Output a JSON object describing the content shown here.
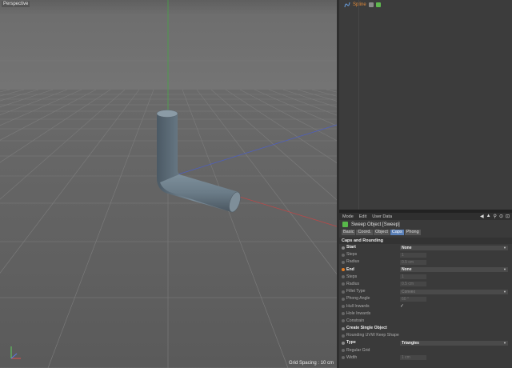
{
  "viewport": {
    "label": "Perspective",
    "grid_spacing": "Grid Spacing : 10 cm"
  },
  "object_manager": {
    "object_name": "Spline",
    "tag_colors": [
      "#8a8a8a",
      "#5fb84f"
    ]
  },
  "attribute_manager": {
    "menu": [
      "Mode",
      "Edit",
      "User Data"
    ],
    "object_title": "Sweep Object [Sweep]",
    "tabs": [
      "Basic",
      "Coord.",
      "Object",
      "Caps",
      "Phong"
    ],
    "active_tab": "Caps",
    "section": "Caps and Rounding",
    "params": [
      {
        "label": "Start",
        "value": "None",
        "kind": "dropdown",
        "hi": true
      },
      {
        "label": "Steps",
        "value": "1",
        "kind": "num",
        "dim": true
      },
      {
        "label": "Radius",
        "value": "0.5 cm",
        "kind": "num",
        "dim": true
      },
      {
        "label": "End",
        "value": "None",
        "kind": "dropdown",
        "hi": true,
        "orange": true
      },
      {
        "label": "Steps",
        "value": "1",
        "kind": "num",
        "dim": true
      },
      {
        "label": "Radius",
        "value": "0.5 cm",
        "kind": "num",
        "dim": true
      },
      {
        "label": "Fillet Type",
        "value": "Convex",
        "kind": "dropdown",
        "dim": true
      },
      {
        "label": "Phong Angle",
        "value": "60 °",
        "kind": "num",
        "dim": true
      },
      {
        "label": "Hull Inwards",
        "value": "✓",
        "kind": "check"
      },
      {
        "label": "Hole Inwards",
        "value": "",
        "kind": "check"
      },
      {
        "label": "Constrain",
        "value": "",
        "kind": "check"
      },
      {
        "label": "Create Single Object",
        "value": "",
        "kind": "check",
        "hi": true
      },
      {
        "label": "Rounding UVW Keep Shape",
        "value": "",
        "kind": "check"
      },
      {
        "label": "Type",
        "value": "Triangles",
        "kind": "dropdown",
        "hi": true
      },
      {
        "label": "Regular Grid",
        "value": "",
        "kind": "check"
      },
      {
        "label": "Width",
        "value": "1 cm",
        "kind": "num",
        "dim": true
      }
    ]
  },
  "colors": {
    "viewport_bg": "#6b6b6b",
    "tube": "#6d7f8c",
    "active_tab": "#5a80b8",
    "spline_text": "#e08a3a"
  }
}
